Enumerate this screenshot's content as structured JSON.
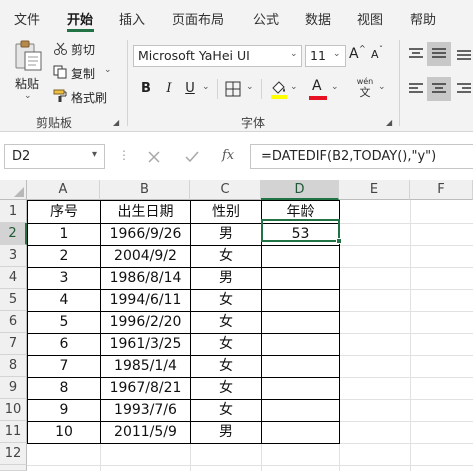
{
  "menu": {
    "tabs": [
      {
        "label": "文件"
      },
      {
        "label": "开始"
      },
      {
        "label": "插入"
      },
      {
        "label": "页面布局"
      },
      {
        "label": "公式"
      },
      {
        "label": "数据"
      },
      {
        "label": "视图"
      },
      {
        "label": "帮助"
      }
    ],
    "active_tab": "开始"
  },
  "ribbon": {
    "clipboard": {
      "paste_label": "粘贴",
      "cut_label": "剪切",
      "copy_label": "复制",
      "format_painter_label": "格式刷",
      "group_label": "剪贴板"
    },
    "font": {
      "font_name": "Microsoft YaHei UI",
      "font_size": "11",
      "grow_font": "A",
      "shrink_font": "A",
      "bold": "B",
      "italic": "I",
      "underline": "U",
      "font_color_letter": "A",
      "phonetic_top": "wén",
      "phonetic_bottom": "文",
      "group_label": "字体",
      "highlight_color": "#ffff00",
      "font_color": "#e81123"
    }
  },
  "formula_bar": {
    "name_box": "D2",
    "cancel_icon": "cancel-icon",
    "enter_icon": "enter-icon",
    "fx_label": "fx",
    "formula": "=DATEDIF(B2,TODAY(),\"y\")"
  },
  "sheet": {
    "columns": [
      "A",
      "B",
      "C",
      "D",
      "E",
      "F"
    ],
    "rows": [
      "1",
      "2",
      "3",
      "4",
      "5",
      "6",
      "7",
      "8",
      "9",
      "10",
      "11",
      "12"
    ],
    "selected_cell": "D2",
    "headers": [
      "序号",
      "出生日期",
      "性别",
      "年龄"
    ],
    "data": [
      {
        "no": "1",
        "birth": "1966/9/26",
        "gender": "男",
        "age": "53"
      },
      {
        "no": "2",
        "birth": "2004/9/2",
        "gender": "女",
        "age": ""
      },
      {
        "no": "3",
        "birth": "1986/8/14",
        "gender": "男",
        "age": ""
      },
      {
        "no": "4",
        "birth": "1994/6/11",
        "gender": "女",
        "age": ""
      },
      {
        "no": "5",
        "birth": "1996/2/20",
        "gender": "女",
        "age": ""
      },
      {
        "no": "6",
        "birth": "1961/3/25",
        "gender": "女",
        "age": ""
      },
      {
        "no": "7",
        "birth": "1985/1/4",
        "gender": "女",
        "age": ""
      },
      {
        "no": "8",
        "birth": "1967/8/21",
        "gender": "女",
        "age": ""
      },
      {
        "no": "9",
        "birth": "1993/7/6",
        "gender": "女",
        "age": ""
      },
      {
        "no": "10",
        "birth": "2011/5/9",
        "gender": "男",
        "age": ""
      }
    ]
  },
  "accent_color": "#217346"
}
